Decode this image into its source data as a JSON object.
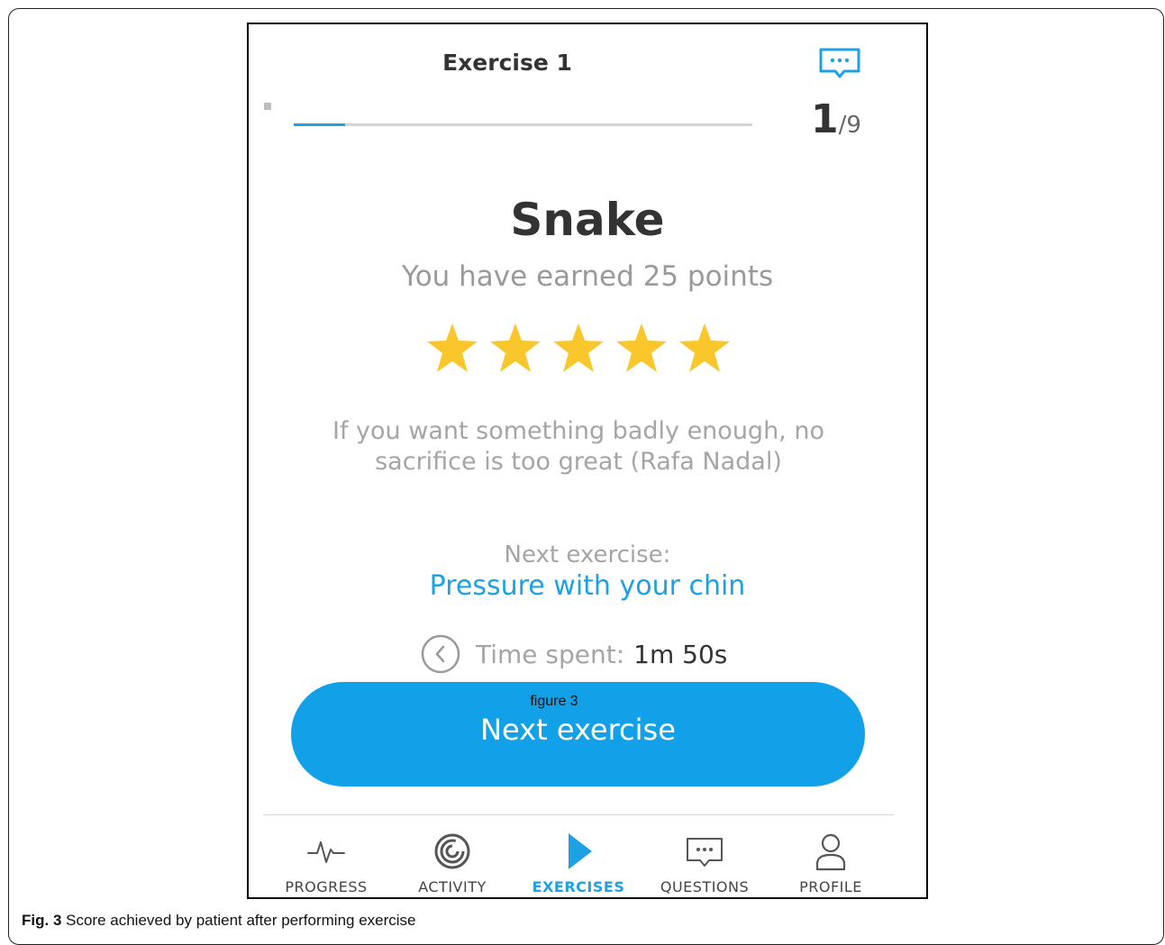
{
  "header": {
    "title": "Exercise 1",
    "progress_current": "1",
    "progress_total": "/9",
    "progress_fraction": 0.111
  },
  "result": {
    "exercise_name": "Snake",
    "points_text": "You have earned 25 points",
    "stars_earned": 5,
    "stars_max": 5,
    "star_color": "#f9c62b",
    "quote": "If you want something badly enough, no sacrifice is too great (Rafa Nadal)"
  },
  "next": {
    "label": "Next exercise:",
    "exercise": "Pressure with your chin"
  },
  "time": {
    "label": "Time spent:",
    "value": "1m 50s"
  },
  "button": {
    "caption": "figure 3",
    "label": "Next exercise"
  },
  "tabs": [
    {
      "label": "PROGRESS",
      "icon": "pulse-icon",
      "active": false
    },
    {
      "label": "ACTIVITY",
      "icon": "activity-rings-icon",
      "active": false
    },
    {
      "label": "EXERCISES",
      "icon": "play-icon",
      "active": true
    },
    {
      "label": "QUESTIONS",
      "icon": "chat-icon",
      "active": false
    },
    {
      "label": "PROFILE",
      "icon": "person-icon",
      "active": false
    }
  ],
  "colors": {
    "accent": "#1ea1e3",
    "button": "#12a1e8",
    "star": "#f9c62b"
  },
  "figure_caption": {
    "label": "Fig. 3",
    "text": " Score achieved by patient after performing exercise"
  }
}
